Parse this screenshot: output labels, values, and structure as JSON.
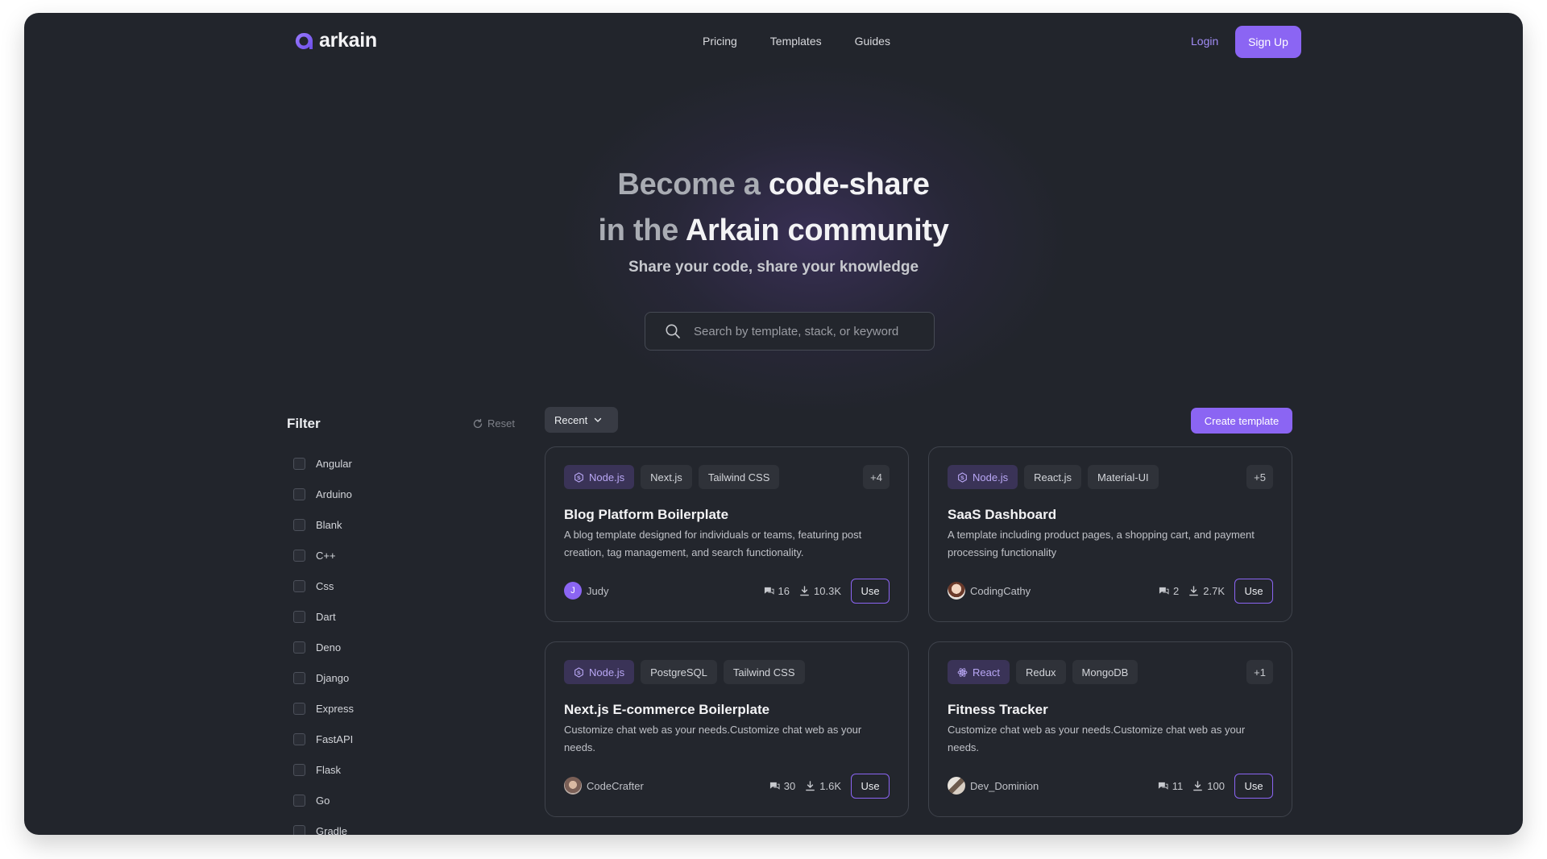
{
  "brand": {
    "name": "arkain"
  },
  "nav": {
    "items": [
      "Pricing",
      "Templates",
      "Guides"
    ],
    "login": "Login",
    "signup": "Sign Up"
  },
  "hero": {
    "line1_pre": "Become a ",
    "line1_hl": "code-share",
    "line2_pre": "in the ",
    "line2_hl": "Arkain community",
    "subtitle": "Share your code, share your knowledge",
    "search_placeholder": "Search by template, stack, or keyword"
  },
  "filter": {
    "title": "Filter",
    "reset": "Reset",
    "items": [
      "Angular",
      "Arduino",
      "Blank",
      "C++",
      "Css",
      "Dart",
      "Deno",
      "Django",
      "Express",
      "FastAPI",
      "Flask",
      "Go",
      "Gradle"
    ]
  },
  "toolbar": {
    "sort": "Recent",
    "create": "Create template"
  },
  "colors": {
    "accent": "#8b65f3",
    "background": "#22252c",
    "card_border": "#3f434c"
  },
  "cards": [
    {
      "tags": [
        "Node.js",
        "Next.js",
        "Tailwind CSS"
      ],
      "primary_icon": "nodejs-icon",
      "more": "+4",
      "title": "Blog Platform Boilerplate",
      "description": "A blog template designed for individuals or teams, featuring post creation, tag management, and search functionality.",
      "author": "Judy",
      "avatar_initial": "J",
      "comments": "16",
      "downloads": "10.3K",
      "action": "Use"
    },
    {
      "tags": [
        "Node.js",
        "React.js",
        "Material-UI"
      ],
      "primary_icon": "nodejs-icon",
      "more": "+5",
      "title": "SaaS Dashboard",
      "description": "A template including product pages, a shopping cart, and payment processing functionality",
      "author": "CodingCathy",
      "avatar_initial": "",
      "comments": "2",
      "downloads": "2.7K",
      "action": "Use"
    },
    {
      "tags": [
        "Node.js",
        "PostgreSQL",
        "Tailwind CSS"
      ],
      "primary_icon": "nodejs-icon",
      "more": "",
      "title": "Next.js E-commerce Boilerplate",
      "description": "Customize chat web as your needs.Customize chat web as your needs.",
      "author": "CodeCrafter",
      "avatar_initial": "",
      "comments": "30",
      "downloads": "1.6K",
      "action": "Use"
    },
    {
      "tags": [
        "React",
        "Redux",
        "MongoDB"
      ],
      "primary_icon": "react-icon",
      "more": "+1",
      "title": "Fitness Tracker",
      "description": "Customize chat web as your needs.Customize chat web as your needs.",
      "author": "Dev_Dominion",
      "avatar_initial": "",
      "comments": "11",
      "downloads": "100",
      "action": "Use"
    }
  ]
}
